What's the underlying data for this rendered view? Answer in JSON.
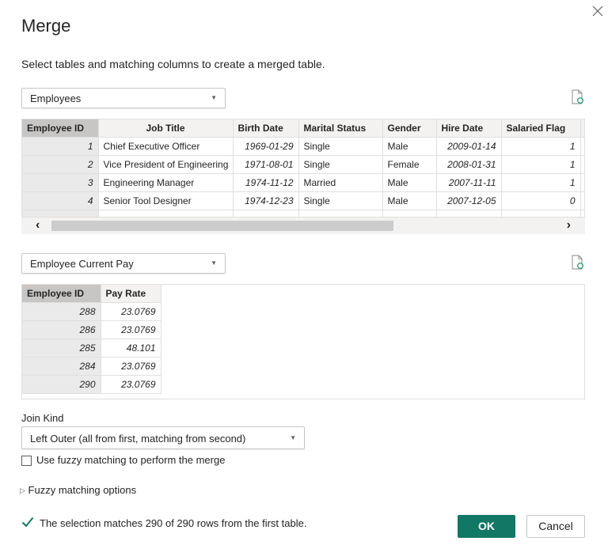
{
  "dialog": {
    "title": "Merge",
    "subtitle": "Select tables and matching columns to create a merged table.",
    "close_icon": "close-icon"
  },
  "first_table": {
    "selected": "Employees",
    "refresh_icon": "refresh-document-icon",
    "columns": [
      "Employee ID",
      "Job Title",
      "Birth Date",
      "Marital Status",
      "Gender",
      "Hire Date",
      "Salaried Flag"
    ],
    "selected_column": "Employee ID",
    "rows": [
      [
        "1",
        "Chief Executive Officer",
        "1969-01-29",
        "Single",
        "Male",
        "2009-01-14",
        "1"
      ],
      [
        "2",
        "Vice President of Engineering",
        "1971-08-01",
        "Single",
        "Female",
        "2008-01-31",
        "1"
      ],
      [
        "3",
        "Engineering Manager",
        "1974-11-12",
        "Married",
        "Male",
        "2007-11-11",
        "1"
      ],
      [
        "4",
        "Senior Tool Designer",
        "1974-12-23",
        "Single",
        "Male",
        "2007-12-05",
        "0"
      ]
    ],
    "scroll": {
      "left_arrow": "‹",
      "right_arrow": "›",
      "position_fraction": 0.0,
      "visible_fraction": 0.68
    }
  },
  "second_table": {
    "selected": "Employee Current Pay",
    "refresh_icon": "refresh-document-icon",
    "columns": [
      "Employee ID",
      "Pay Rate"
    ],
    "selected_column": "Employee ID",
    "rows": [
      [
        "288",
        "23.0769"
      ],
      [
        "286",
        "23.0769"
      ],
      [
        "285",
        "48.101"
      ],
      [
        "284",
        "23.0769"
      ],
      [
        "290",
        "23.0769"
      ]
    ]
  },
  "join": {
    "label": "Join Kind",
    "selected": "Left Outer (all from first, matching from second)"
  },
  "fuzzy": {
    "checkbox_label": "Use fuzzy matching to perform the merge",
    "checked": false,
    "options_label": "Fuzzy matching options"
  },
  "status": {
    "message": "The selection matches 290 of 290 rows from the first table.",
    "color": "#117865"
  },
  "buttons": {
    "ok": "OK",
    "cancel": "Cancel",
    "ok_color": "#117865"
  }
}
